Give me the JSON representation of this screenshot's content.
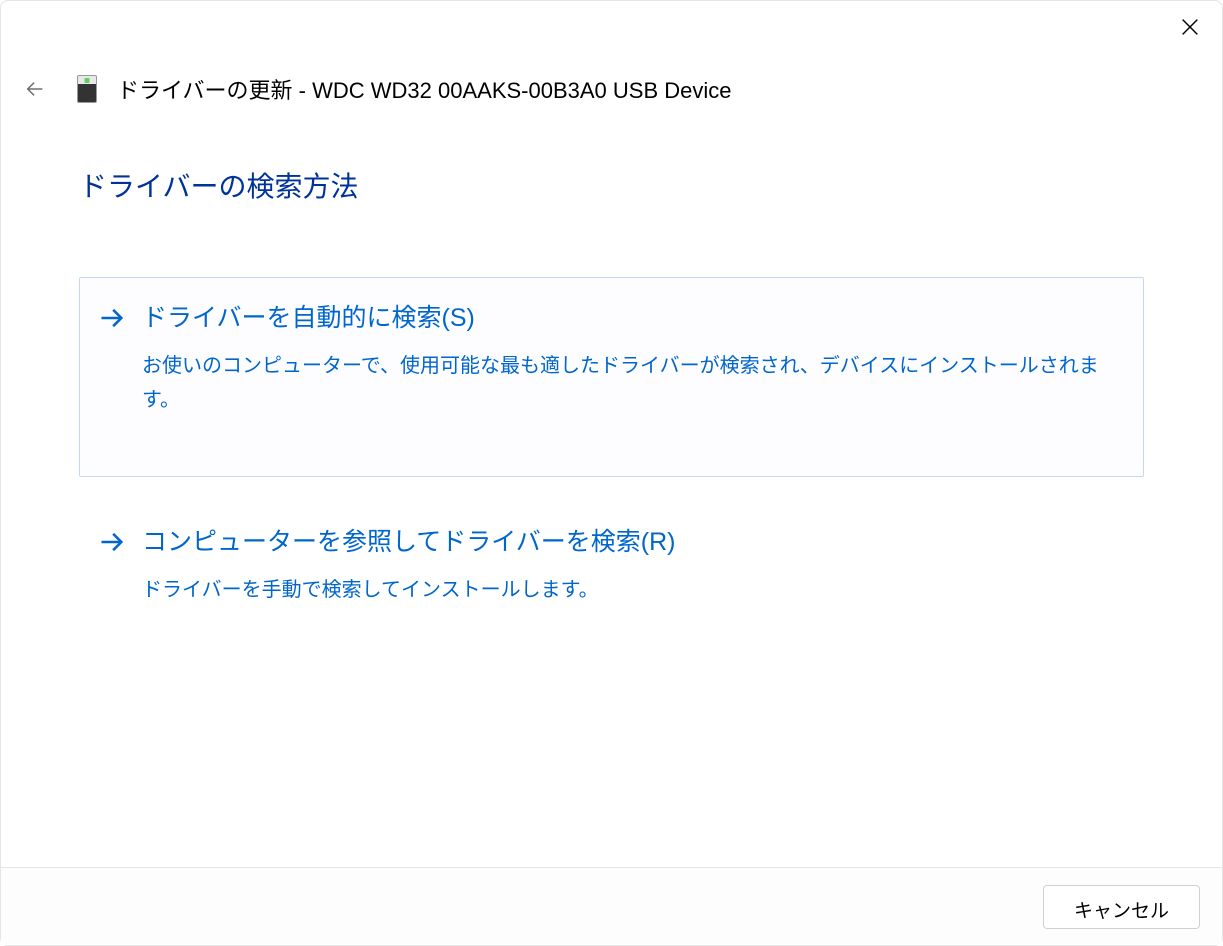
{
  "header": {
    "title": "ドライバーの更新 - WDC WD32 00AAKS-00B3A0 USB Device"
  },
  "content": {
    "heading": "ドライバーの検索方法",
    "options": [
      {
        "title": "ドライバーを自動的に検索(S)",
        "description": "お使いのコンピューターで、使用可能な最も適したドライバーが検索され、デバイスにインストールされます。"
      },
      {
        "title": "コンピューターを参照してドライバーを検索(R)",
        "description": "ドライバーを手動で検索してインストールします。"
      }
    ]
  },
  "footer": {
    "cancel": "キャンセル"
  }
}
